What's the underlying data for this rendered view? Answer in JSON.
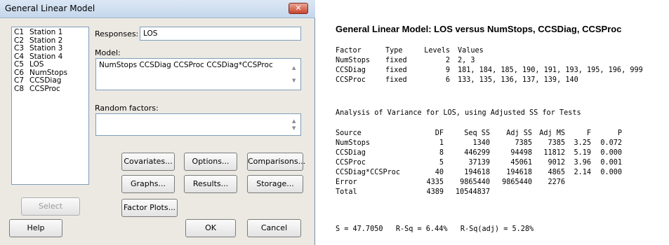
{
  "dialog": {
    "title": "General Linear Model",
    "close_glyph": "✕",
    "variables": [
      {
        "id": "C1",
        "name": "Station 1"
      },
      {
        "id": "C2",
        "name": "Station 2"
      },
      {
        "id": "C3",
        "name": "Station 3"
      },
      {
        "id": "C4",
        "name": "Station 4"
      },
      {
        "id": "C5",
        "name": "LOS"
      },
      {
        "id": "C6",
        "name": "NumStops"
      },
      {
        "id": "C7",
        "name": "CCSDiag"
      },
      {
        "id": "C8",
        "name": "CCSProc"
      }
    ],
    "responses_label": "Responses:",
    "responses_value": "LOS",
    "model_label": "Model:",
    "model_value": "NumStops CCSDiag CCSProc CCSDiag*CCSProc",
    "random_factors_label": "Random factors:",
    "random_factors_value": "",
    "buttons": {
      "covariates": "Covariates...",
      "options": "Options...",
      "comparisons": "Comparisons...",
      "graphs": "Graphs...",
      "results": "Results...",
      "storage": "Storage...",
      "factor_plots": "Factor Plots...",
      "select": "Select",
      "help": "Help",
      "ok": "OK",
      "cancel": "Cancel"
    }
  },
  "output": {
    "title": "General Linear Model: LOS versus NumStops, CCSDiag, CCSProc",
    "factor_headers": [
      "Factor",
      "Type",
      "Levels",
      "Values"
    ],
    "factors": [
      {
        "factor": "NumStops",
        "type": "fixed",
        "levels": "2",
        "values": "2, 3"
      },
      {
        "factor": "CCSDiag",
        "type": "fixed",
        "levels": "9",
        "values": "181, 184, 185, 190, 191, 193, 195, 196, 999"
      },
      {
        "factor": "CCSProc",
        "type": "fixed",
        "levels": "6",
        "values": "133, 135, 136, 137, 139, 140"
      }
    ],
    "anova_heading": "Analysis of Variance for LOS, using Adjusted SS for Tests",
    "anova_headers": [
      "Source",
      "DF",
      "Seq SS",
      "Adj SS",
      "Adj MS",
      "F",
      "P"
    ],
    "anova_rows": [
      [
        "NumStops",
        "1",
        "1340",
        "7385",
        "7385",
        "3.25",
        "0.072"
      ],
      [
        "CCSDiag",
        "8",
        "446299",
        "94498",
        "11812",
        "5.19",
        "0.000"
      ],
      [
        "CCSProc",
        "5",
        "37139",
        "45061",
        "9012",
        "3.96",
        "0.001"
      ],
      [
        "CCSDiag*CCSProc",
        "40",
        "194618",
        "194618",
        "4865",
        "2.14",
        "0.000"
      ],
      [
        "Error",
        "4335",
        "9865440",
        "9865440",
        "2276",
        "",
        ""
      ],
      [
        "Total",
        "4389",
        "10544837",
        "",
        "",
        "",
        ""
      ]
    ],
    "stats_line": "S = 47.7050   R-Sq = 6.44%   R-Sq(adj) = 5.28%"
  }
}
